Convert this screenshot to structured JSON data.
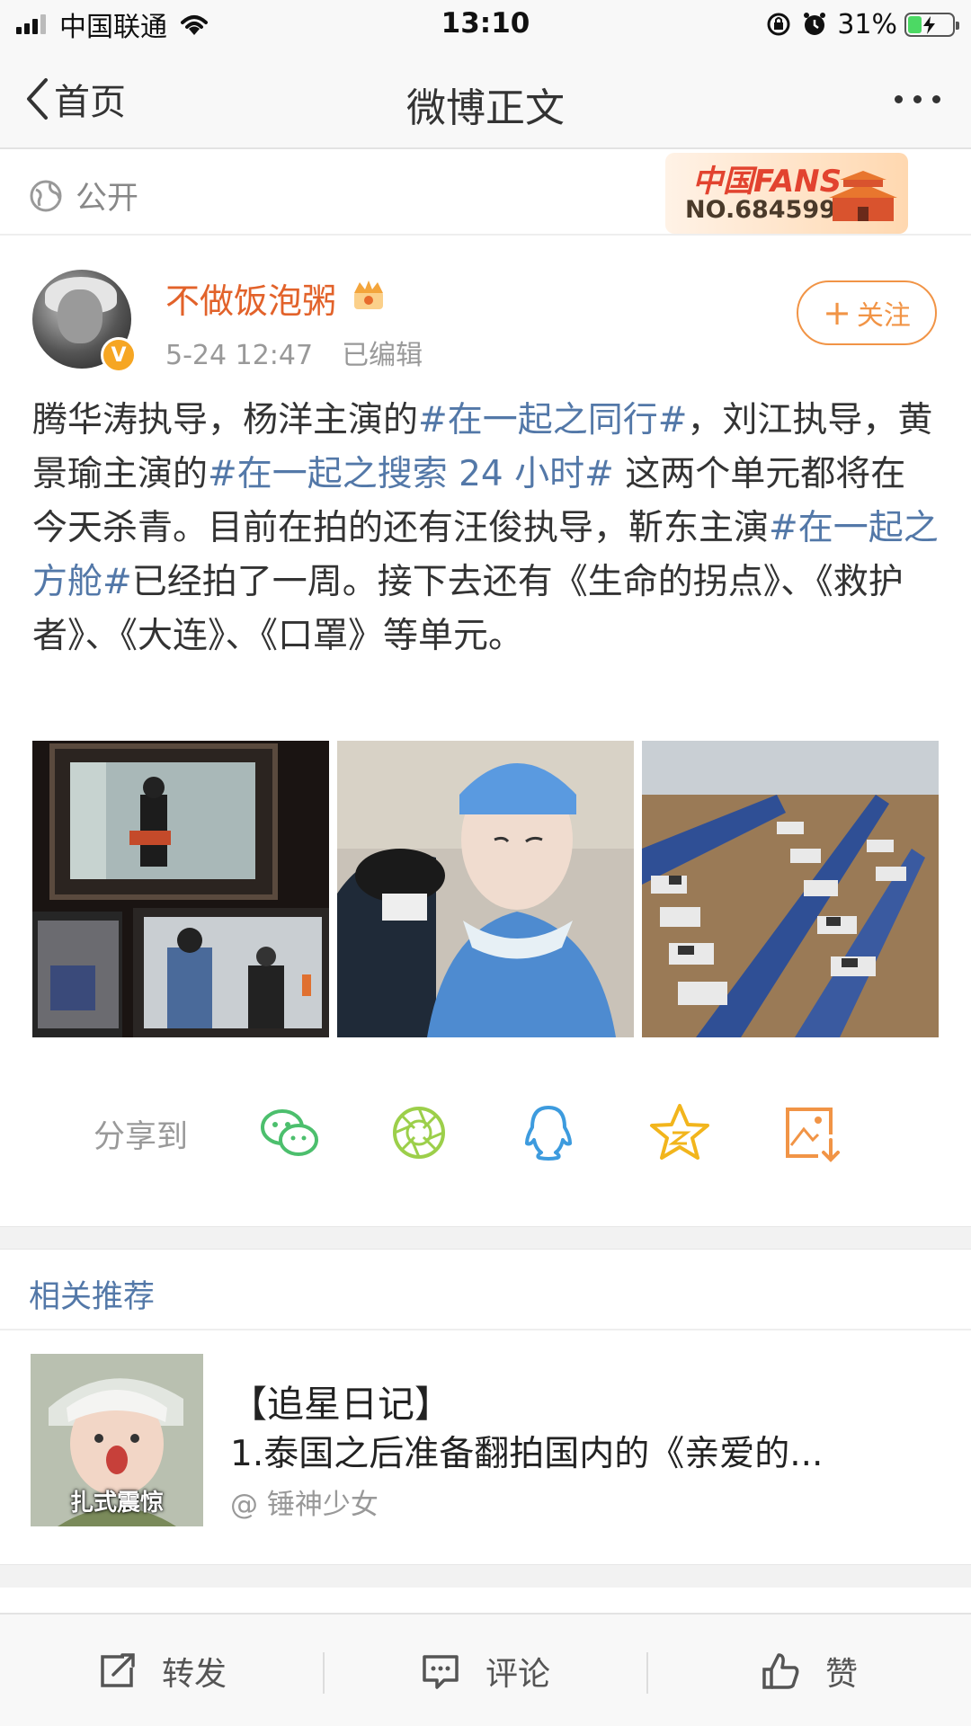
{
  "status_bar": {
    "carrier": "中国联通",
    "time": "13:10",
    "battery_percent": "31%",
    "battery_level": 0.31,
    "signal_bars": 3
  },
  "nav": {
    "back_label": "首页",
    "title": "微博正文"
  },
  "visibility": {
    "label": "公开",
    "icon": "globe-icon"
  },
  "fans_badge": {
    "title": "中国FANS",
    "number": "NO.6845995"
  },
  "post": {
    "author": "不做饭泡粥",
    "time": "5-24 12:47",
    "edited": "已编辑",
    "follow_label": "关注",
    "verified_mark": "V",
    "text": {
      "p1": "腾华涛执导，杨洋主演的",
      "tag1": "#在一起之同行#",
      "p2": "，刘江执导，黄景瑜主演的",
      "tag2": "#在一起之搜索 24 小时#",
      "p3": " 这两个单元都将在今天杀青。目前在拍的还有汪俊执导，靳东主演",
      "tag3": "#在一起之方舱#",
      "p4": "已经拍了一周。接下去还有《生命的拐点》、《救护者》、《大连》、《口罩》等单元。"
    },
    "images": [
      "film-monitor-photo",
      "surgeon-portrait-photo",
      "field-hospital-photo"
    ]
  },
  "share": {
    "label": "分享到",
    "targets": [
      "wechat-icon",
      "moments-icon",
      "qq-icon",
      "qzone-icon",
      "save-image-icon"
    ]
  },
  "recommend": {
    "title": "相关推荐",
    "item": {
      "line1": "【追星日记】",
      "line2": "1.泰国之后准备翻拍国内的《亲爱的...",
      "author": "@ 锤神少女",
      "thumb_caption": "扎式震惊"
    }
  },
  "toolbar": {
    "repost": "转发",
    "comment": "评论",
    "like": "赞"
  },
  "colors": {
    "accent_orange": "#f19446",
    "username_orange": "#e2622a",
    "link_blue": "#5378a8"
  }
}
